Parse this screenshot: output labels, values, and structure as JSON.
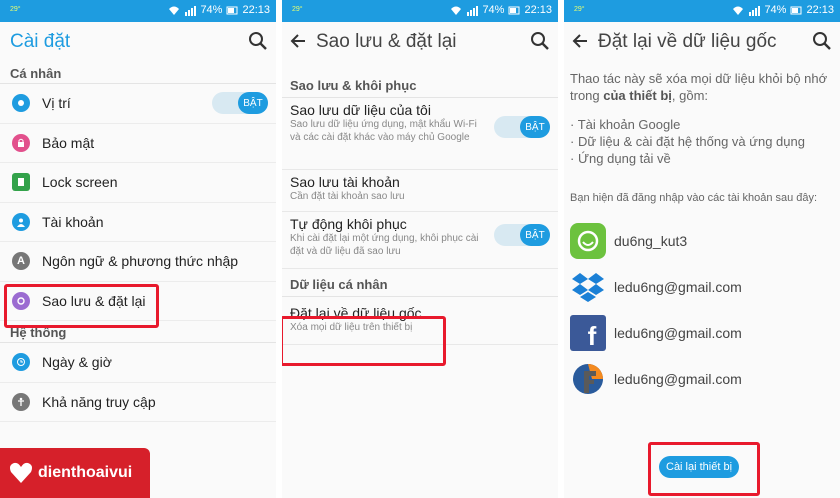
{
  "status": {
    "temp": "29°",
    "battery": "74%",
    "time": "22:13"
  },
  "p1": {
    "title": "Cài đặt",
    "sect_personal": "Cá nhân",
    "items": [
      {
        "label": "Vị trí",
        "color": "#1e9ce0"
      },
      {
        "label": "Bảo mật",
        "color": "#e2508c"
      },
      {
        "label": "Lock screen",
        "color": "#33a24a"
      },
      {
        "label": "Tài khoản",
        "color": "#1e9ce0"
      },
      {
        "label": "Ngôn ngữ & phương thức nhập",
        "color": "#777777"
      },
      {
        "label": "Sao lưu & đặt lại",
        "color": "#9b6bd1"
      }
    ],
    "toggle": "BẬT",
    "sect_system": "Hệ thống",
    "items2": [
      {
        "label": "Ngày & giờ",
        "color": "#1e9ce0"
      },
      {
        "label": "Khả năng truy cập",
        "color": "#777777"
      }
    ]
  },
  "p2": {
    "title": "Sao lưu & đặt lại",
    "sect_backup": "Sao lưu & khôi phục",
    "item1_title": "Sao lưu dữ liệu của tôi",
    "item1_sub": "Sao lưu dữ liệu ứng dụng, mật khẩu Wi-Fi và các cài đặt khác vào máy chủ Google",
    "item2_title": "Sao lưu tài khoản",
    "item2_sub": "Cần đặt tài khoản sao lưu",
    "item3_title": "Tự động khôi phục",
    "item3_sub": "Khi cài đặt lại một ứng dụng, khôi phục cài đặt và dữ liệu đã sao lưu",
    "toggle": "BẬT",
    "sect_personal": "Dữ liệu cá nhân",
    "item4_title": "Đặt lại về dữ liệu gốc",
    "item4_sub": "Xóa mọi dữ liệu trên thiết bị"
  },
  "p3": {
    "title": "Đặt lại về dữ liệu gốc",
    "intro": "Thao tác này sẽ xóa mọi dữ liệu khỏi bộ nhớ trong",
    "intro_bold": "của thiết bị",
    "intro_end": ", gồm:",
    "bullets": [
      "Tài khoản Google",
      "Dữ liệu & cài đặt hệ thống và ứng dụng",
      "Ứng dụng tải về"
    ],
    "signed_in": "Bạn hiện đã đăng nhập vào các tài khoản sau đây:",
    "accounts": [
      "du6ng_kut3",
      "ledu6ng@gmail.com",
      "ledu6ng@gmail.com",
      "ledu6ng@gmail.com"
    ],
    "reset_button": "Cài lại thiết bị"
  },
  "brand": {
    "name": "dienthoaivui"
  },
  "colors": {
    "accent": "#1e9ce0",
    "highlight": "#e8192c",
    "brand": "#d6202a"
  }
}
